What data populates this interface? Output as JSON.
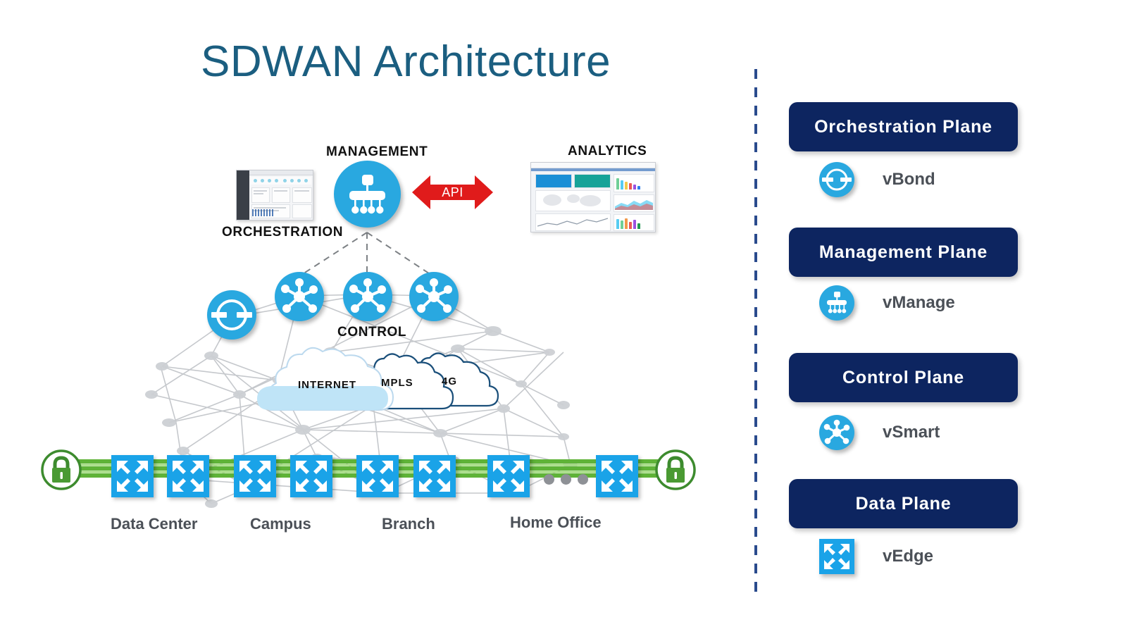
{
  "title": "SDWAN Architecture",
  "colors": {
    "title": "#1b5e80",
    "plane_box": "#0d2560",
    "node_blue": "#29a8e0",
    "edge_blue": "#1aa3e8",
    "api_arrow": "#e01b1b",
    "tunnel_green": "#5fb338",
    "lock_green": "#3d8b2e",
    "divider": "#2a4b8d",
    "label_gray": "#4b5057"
  },
  "diagram": {
    "captions": {
      "management": "MANAGEMENT",
      "analytics": "ANALYTICS",
      "orchestration": "ORCHESTRATION",
      "control": "CONTROL"
    },
    "api_label": "API",
    "clouds": [
      {
        "name": "INTERNET"
      },
      {
        "name": "MPLS"
      },
      {
        "name": "4G"
      }
    ],
    "sites": [
      {
        "label": "Data Center"
      },
      {
        "label": "Campus"
      },
      {
        "label": "Branch"
      },
      {
        "label": "Home Office"
      }
    ],
    "ellipsis_dots": 3
  },
  "legend": {
    "planes": [
      {
        "title": "Orchestration Plane",
        "component": "vBond",
        "icon": "vbond-icon"
      },
      {
        "title": "Management Plane",
        "component": "vManage",
        "icon": "vmanage-icon"
      },
      {
        "title": "Control Plane",
        "component": "vSmart",
        "icon": "vsmart-icon"
      },
      {
        "title": "Data Plane",
        "component": "vEdge",
        "icon": "vedge-icon"
      }
    ]
  }
}
